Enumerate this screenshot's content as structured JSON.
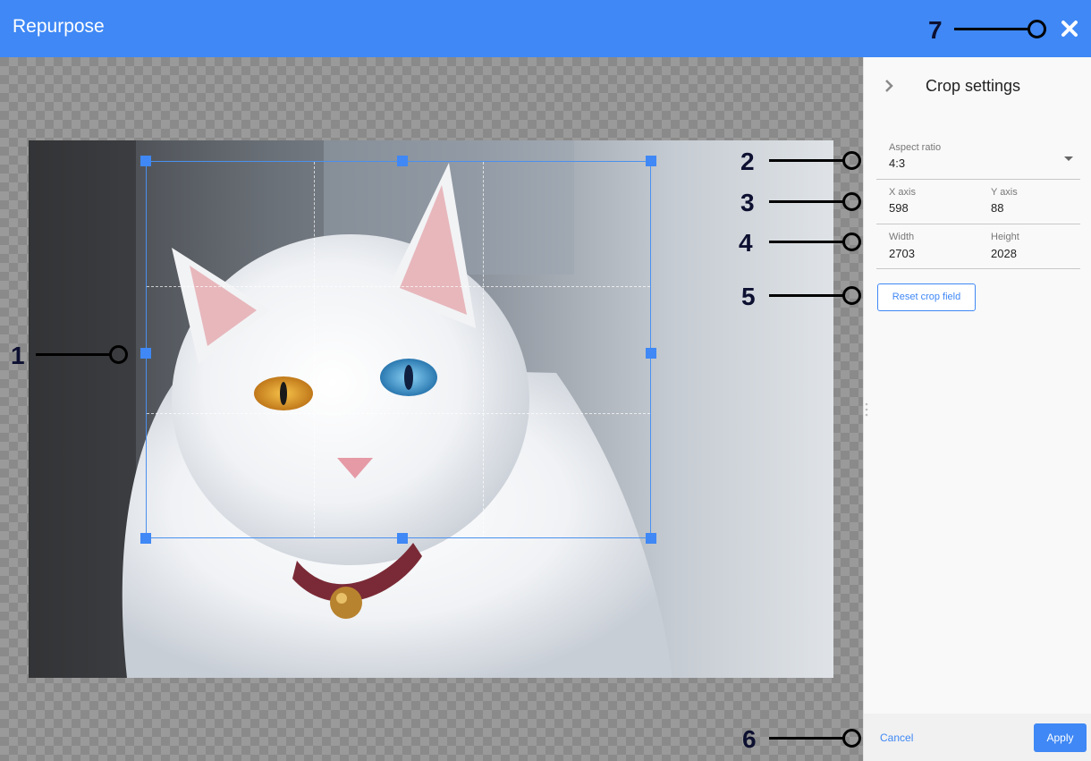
{
  "header": {
    "title": "Repurpose",
    "close_icon": "close-icon"
  },
  "colors": {
    "accent": "#3f88f5",
    "header_bg": "#3f88f5",
    "panel_bg": "#f9f9f9"
  },
  "image": {
    "subject": "white-cat-photo"
  },
  "sidebar": {
    "title": "Crop settings",
    "toggle_icon": "chevron-right-icon",
    "aspect_ratio": {
      "label": "Aspect ratio",
      "value": "4:3"
    },
    "x_axis": {
      "label": "X axis",
      "value": "598"
    },
    "y_axis": {
      "label": "Y axis",
      "value": "88"
    },
    "width": {
      "label": "Width",
      "value": "2703"
    },
    "height": {
      "label": "Height",
      "value": "2028"
    },
    "reset_label": "Reset crop field"
  },
  "footer": {
    "cancel_label": "Cancel",
    "apply_label": "Apply"
  },
  "callouts": [
    "1",
    "2",
    "3",
    "4",
    "5",
    "6",
    "7"
  ]
}
